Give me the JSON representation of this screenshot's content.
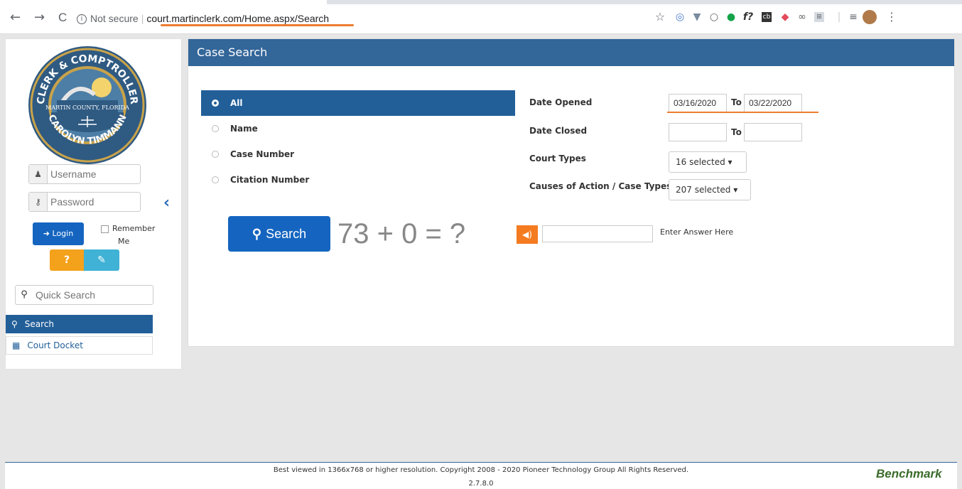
{
  "browser": {
    "back_icon": "←",
    "forward_icon": "→",
    "reload_icon": "C",
    "security_label": "Not secure",
    "url": "court.martinclerk.com/Home.aspx/Search",
    "highlight_color": "#ed7d31"
  },
  "sidebar": {
    "seal": {
      "top_text": "CLERK & COMPTROLLER",
      "middle_text": "MARTIN COUNTY, FLORIDA",
      "bottom_text": "CAROLYN TIMMANN"
    },
    "username_placeholder": "Username",
    "password_placeholder": "Password",
    "login_label": "Login",
    "remember_line1": "Remember",
    "remember_line2": "Me",
    "quick_search_placeholder": "Quick Search",
    "menu": [
      {
        "label": "Search",
        "icon": "search-icon"
      },
      {
        "label": "Court Docket",
        "icon": "calendar-icon"
      }
    ]
  },
  "main": {
    "title": "Case Search",
    "options": [
      {
        "label": "All",
        "selected": true
      },
      {
        "label": "Name",
        "selected": false
      },
      {
        "label": "Case Number",
        "selected": false
      },
      {
        "label": "Citation Number",
        "selected": false
      }
    ],
    "search_label": "Search",
    "captcha_text": "73 + 0 = ?",
    "answer_label": "Enter Answer Here",
    "date_opened_label": "Date Opened",
    "date_opened_from": "03/16/2020",
    "date_opened_to": "03/22/2020",
    "date_closed_label": "Date Closed",
    "date_closed_from": "",
    "date_closed_to": "",
    "to_label": "To",
    "court_types_label": "Court Types",
    "court_types_value": "16 selected ▾",
    "causes_label": "Causes of Action / Case Types",
    "causes_value": "207 selected ▾",
    "header_color": "#336699",
    "accent_color": "#225f99"
  },
  "footer": {
    "copyright": "Best viewed in 1366x768 or higher resolution. Copyright 2008 - 2020 Pioneer Technology Group All Rights Reserved.",
    "version": "2.7.8.0",
    "brand": "Benchmark"
  }
}
